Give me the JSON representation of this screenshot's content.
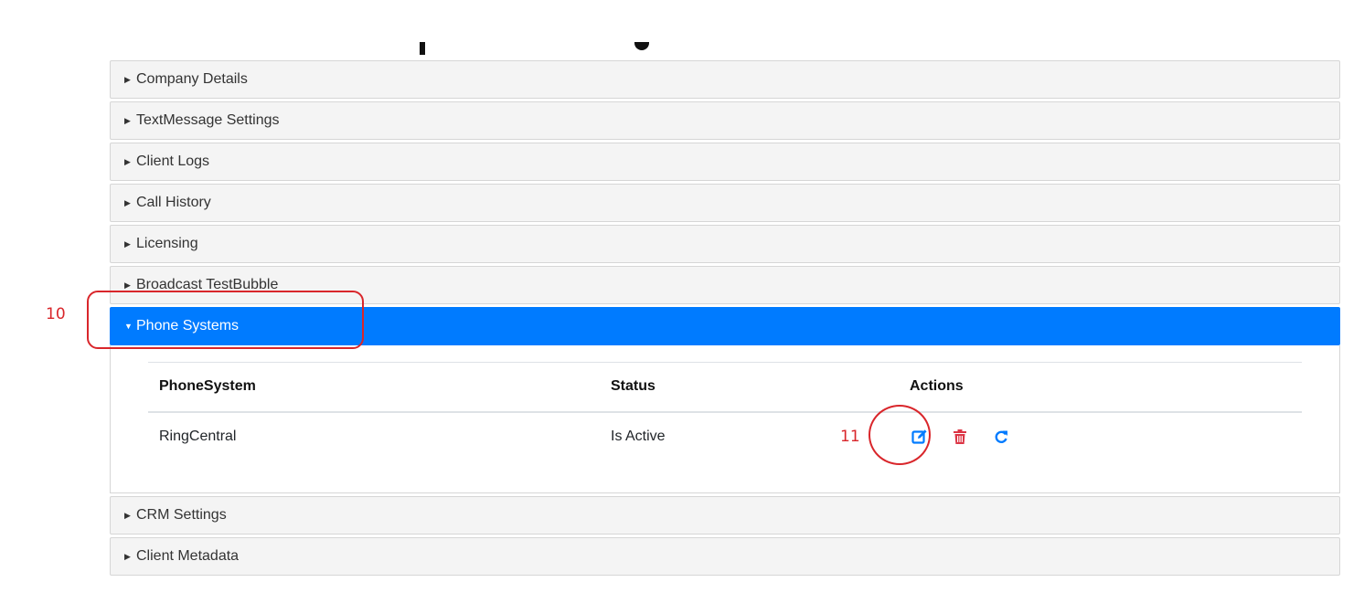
{
  "accordion": {
    "sections_above": [
      {
        "label": "Company Details"
      },
      {
        "label": "TextMessage Settings"
      },
      {
        "label": "Client Logs"
      },
      {
        "label": "Call History"
      },
      {
        "label": "Licensing"
      },
      {
        "label": "Broadcast TestBubble"
      }
    ],
    "active_section": {
      "label": "Phone Systems"
    },
    "sections_below": [
      {
        "label": "CRM Settings"
      },
      {
        "label": "Client Metadata"
      }
    ]
  },
  "phone_systems_table": {
    "headers": {
      "phone_system": "PhoneSystem",
      "status": "Status",
      "actions": "Actions"
    },
    "rows": [
      {
        "phone_system": "RingCentral",
        "status": "Is Active",
        "actions": [
          "edit-icon",
          "trash-icon",
          "refresh-icon"
        ]
      }
    ]
  },
  "annotations": {
    "step_10": "10",
    "step_11": "11"
  },
  "colors": {
    "active_header": "#007bff",
    "delete": "#dc3545",
    "annotation": "#d9262b"
  }
}
